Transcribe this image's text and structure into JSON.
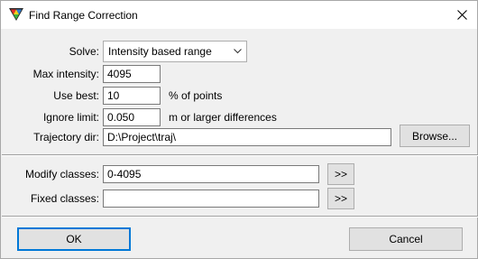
{
  "window": {
    "title": "Find Range Correction"
  },
  "form": {
    "solve_label": "Solve:",
    "solve_value": "Intensity based range",
    "max_intensity_label": "Max intensity:",
    "max_intensity_value": "4095",
    "use_best_label": "Use best:",
    "use_best_value": "10",
    "use_best_unit": "% of points",
    "ignore_limit_label": "Ignore limit:",
    "ignore_limit_value": "0.050",
    "ignore_limit_unit": "m or larger differences",
    "trajectory_dir_label": "Trajectory dir:",
    "trajectory_dir_value": "D:\\Project\\traj\\",
    "browse_label": "Browse..."
  },
  "classes": {
    "modify_label": "Modify classes:",
    "modify_value": "0-4095",
    "fixed_label": "Fixed classes:",
    "fixed_value": "",
    "more_label": ">>"
  },
  "footer": {
    "ok_label": "OK",
    "cancel_label": "Cancel"
  },
  "icons": {
    "app": "terrasolid-triangle-icon",
    "close": "close-icon",
    "dropdown": "chevron-down-icon"
  }
}
